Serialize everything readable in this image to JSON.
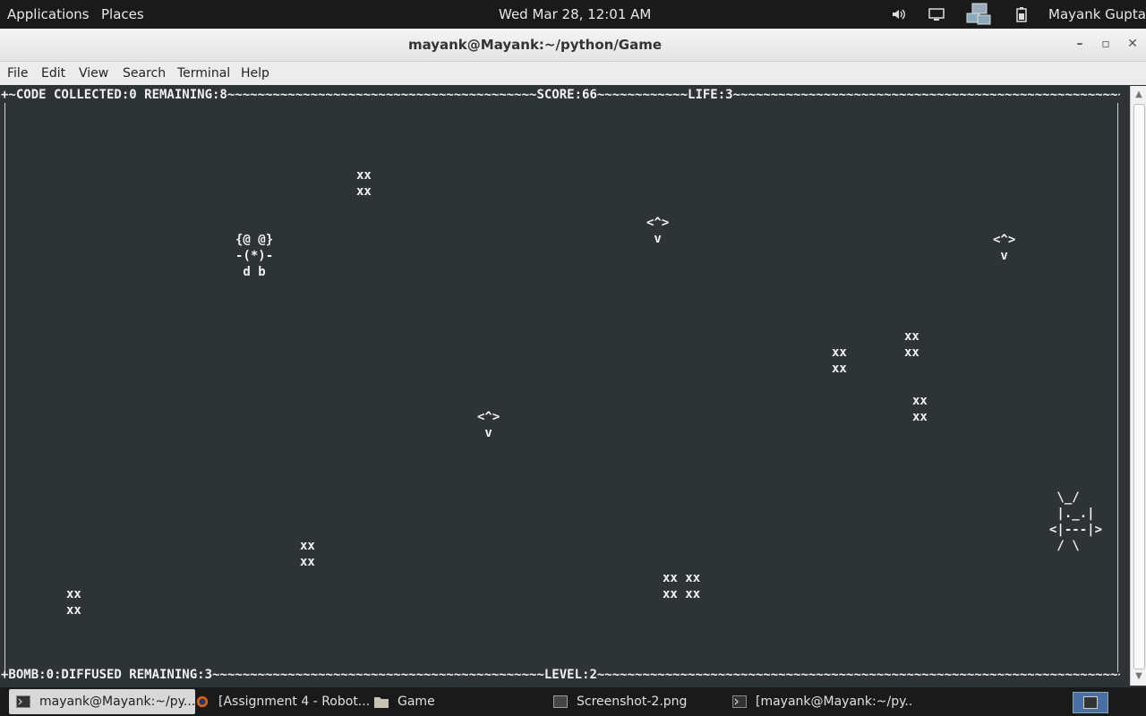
{
  "panel": {
    "applications": "Applications",
    "places": "Places",
    "clock": "Wed Mar 28, 12:01 AM",
    "user": "Mayank Gupta"
  },
  "window": {
    "title": "mayank@Mayank:~/python/Game",
    "menus": [
      "File",
      "Edit",
      "View",
      "Search",
      "Terminal",
      "Help"
    ]
  },
  "game": {
    "top_border": "+~CODE COLLECTED:0 REMAINING:8~~~~~~~~~~~~~~~~~~~~~~~~~~~~~~~~~~~~~~~~~SCORE:66~~~~~~~~~~~~LIFE:3~~~~~~~~~~~~~~~~~~~~~~~~~~~~~~~~~~~~~~~~~~~~~~~~~~~~~~~~~~~~~~~~~~~~~~~~~~~~~~~~~~~~~~~~~~~~~~~~~~~~~~~~~~+",
    "bottom_border": "+BOMB:0:DIFFUSED REMAINING:3~~~~~~~~~~~~~~~~~~~~~~~~~~~~~~~~~~~~~~~~~~~~LEVEL:2~~~~~~~~~~~~~~~~~~~~~~~~~~~~~~~~~~~~~~~~~~~~~~~~~~~~~~~~~~~~~~~~~~~~~~~~~~~~~~~~~~~~~~~~~~~~~~~~~~~~~~~~~~~~~~~~~~~~~~~~~~~~~~~~~~~~+",
    "codes": [
      {
        "text": "xx\nxx"
      },
      {
        "text": "xx\nxx"
      },
      {
        "text": "xx\nxx"
      },
      {
        "text": "xx\nxx"
      },
      {
        "text": "xx\nxx"
      },
      {
        "text": "xx\nxx"
      },
      {
        "text": "xx xx\nxx xx"
      }
    ],
    "bombs": [
      {
        "text": "<^>\n v"
      },
      {
        "text": "<^>\n v"
      },
      {
        "text": "<^>\n v"
      }
    ],
    "enemy": "{@ @}\n-(*)-\n d b",
    "robot": " \\_/\n |._.|\n<|---|>\n / \\"
  },
  "taskbar": [
    {
      "label": "mayank@Mayank:~/py...",
      "icon": "terminal-icon",
      "active": true
    },
    {
      "label": "[Assignment 4 - Robot...",
      "icon": "firefox-icon",
      "active": false
    },
    {
      "label": "Game",
      "icon": "folder-icon",
      "active": false
    },
    {
      "label": "Screenshot-2.png",
      "icon": "image-icon",
      "active": false
    },
    {
      "label": "[mayank@Mayank:~/py...",
      "icon": "terminal-icon",
      "active": false
    }
  ]
}
